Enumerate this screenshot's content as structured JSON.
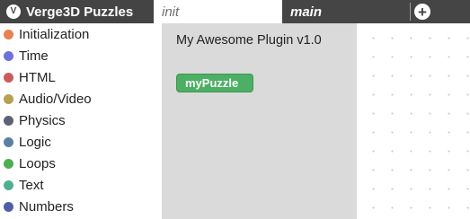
{
  "app": {
    "title": "Verge3D Puzzles",
    "logo_glyph": "V"
  },
  "tabs": [
    {
      "label": "init",
      "active": true
    },
    {
      "label": "main",
      "active": false
    }
  ],
  "add_tab_glyph": "+",
  "toolbox": {
    "categories": [
      {
        "label": "Initialization",
        "color": "#e9824f"
      },
      {
        "label": "Time",
        "color": "#6f6fdc"
      },
      {
        "label": "HTML",
        "color": "#cc5c5c"
      },
      {
        "label": "Audio/Video",
        "color": "#b5a24e"
      },
      {
        "label": "Physics",
        "color": "#5e6272"
      },
      {
        "label": "Logic",
        "color": "#5b80a5"
      },
      {
        "label": "Loops",
        "color": "#4caf50"
      },
      {
        "label": "Text",
        "color": "#4fb08f"
      },
      {
        "label": "Numbers",
        "color": "#4e5fa8"
      }
    ]
  },
  "flyout": {
    "plugin_title": "My Awesome Plugin v1.0",
    "block_label": "myPuzzle",
    "block_color": "#4caf63"
  }
}
